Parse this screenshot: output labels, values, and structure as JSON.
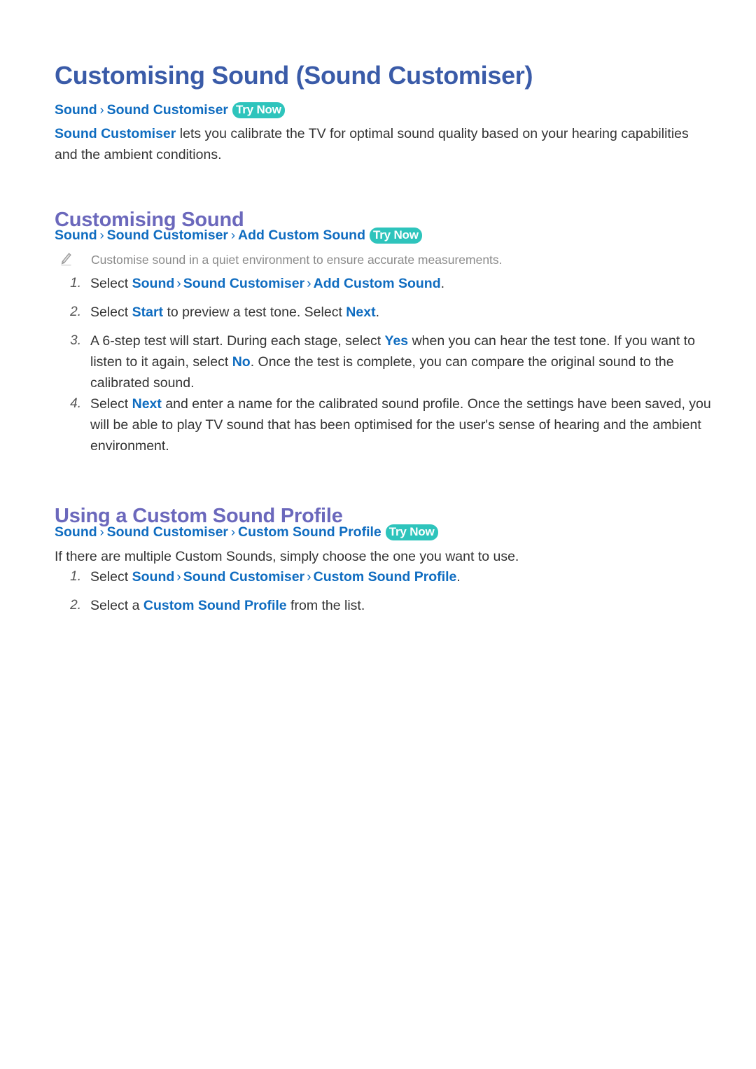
{
  "document": {
    "title": "Customising Sound (Sound Customiser)"
  },
  "intro": {
    "breadcrumb": {
      "segments": [
        "Sound",
        "Sound Customiser"
      ],
      "separator": "›",
      "badge": "Try Now"
    },
    "paragraph": {
      "keyword": "Sound Customiser",
      "rest": " lets you calibrate the TV for optimal sound quality based on your hearing capabilities and the ambient conditions."
    }
  },
  "sections": [
    {
      "heading": "Customising Sound",
      "breadcrumb": {
        "segments": [
          "Sound",
          "Sound Customiser",
          "Add Custom Sound"
        ],
        "separator": "›",
        "badge": "Try Now"
      },
      "note": {
        "icon": "pencil-icon",
        "text": "Customise sound in a quiet environment to ensure accurate measurements."
      },
      "steps": [
        {
          "number": "1.",
          "parts": [
            {
              "t": "Select ",
              "s": "plain"
            },
            {
              "t": "Sound",
              "s": "kw"
            },
            {
              "t": "›",
              "s": "sep"
            },
            {
              "t": "Sound Customiser",
              "s": "kw"
            },
            {
              "t": "›",
              "s": "sep"
            },
            {
              "t": "Add Custom Sound",
              "s": "kw"
            },
            {
              "t": ".",
              "s": "plain"
            }
          ]
        },
        {
          "number": "2.",
          "parts": [
            {
              "t": "Select ",
              "s": "plain"
            },
            {
              "t": "Start",
              "s": "kw"
            },
            {
              "t": " to preview a test tone. Select ",
              "s": "plain"
            },
            {
              "t": "Next",
              "s": "kw"
            },
            {
              "t": ".",
              "s": "plain"
            }
          ]
        },
        {
          "number": "3.",
          "parts": [
            {
              "t": "A 6-step test will start. During each stage, select ",
              "s": "plain"
            },
            {
              "t": "Yes",
              "s": "kw"
            },
            {
              "t": " when you can hear the test tone. If you want to listen to it again, select ",
              "s": "plain"
            },
            {
              "t": "No",
              "s": "kw"
            },
            {
              "t": ". Once the test is complete, you can compare the original sound to the calibrated sound.",
              "s": "plain"
            }
          ]
        },
        {
          "number": "4.",
          "parts": [
            {
              "t": "Select ",
              "s": "plain"
            },
            {
              "t": "Next",
              "s": "kw"
            },
            {
              "t": " and enter a name for the calibrated sound profile. Once the settings have been saved, you will be able to play TV sound that has been optimised for the user's sense of hearing and the ambient environment.",
              "s": "plain"
            }
          ]
        }
      ]
    },
    {
      "heading": "Using a Custom Sound Profile",
      "breadcrumb": {
        "segments": [
          "Sound",
          "Sound Customiser",
          "Custom Sound Profile"
        ],
        "separator": "›",
        "badge": "Try Now"
      },
      "paragraph": "If there are multiple Custom Sounds, simply choose the one you want to use.",
      "steps": [
        {
          "number": "1.",
          "parts": [
            {
              "t": "Select ",
              "s": "plain"
            },
            {
              "t": "Sound",
              "s": "kw"
            },
            {
              "t": "›",
              "s": "sep"
            },
            {
              "t": "Sound Customiser",
              "s": "kw"
            },
            {
              "t": "›",
              "s": "sep"
            },
            {
              "t": "Custom Sound Profile",
              "s": "kw"
            },
            {
              "t": ".",
              "s": "plain"
            }
          ]
        },
        {
          "number": "2.",
          "parts": [
            {
              "t": "Select a ",
              "s": "plain"
            },
            {
              "t": "Custom Sound Profile",
              "s": "kw"
            },
            {
              "t": " from the list.",
              "s": "plain"
            }
          ]
        }
      ]
    }
  ],
  "colors": {
    "title_blue": "#3A5BA8",
    "section_purple": "#6B68BC",
    "link_blue": "#0F6CC0",
    "badge_teal": "#2EC4BC",
    "body_text": "#333333",
    "note_gray": "#8A8A8A"
  }
}
